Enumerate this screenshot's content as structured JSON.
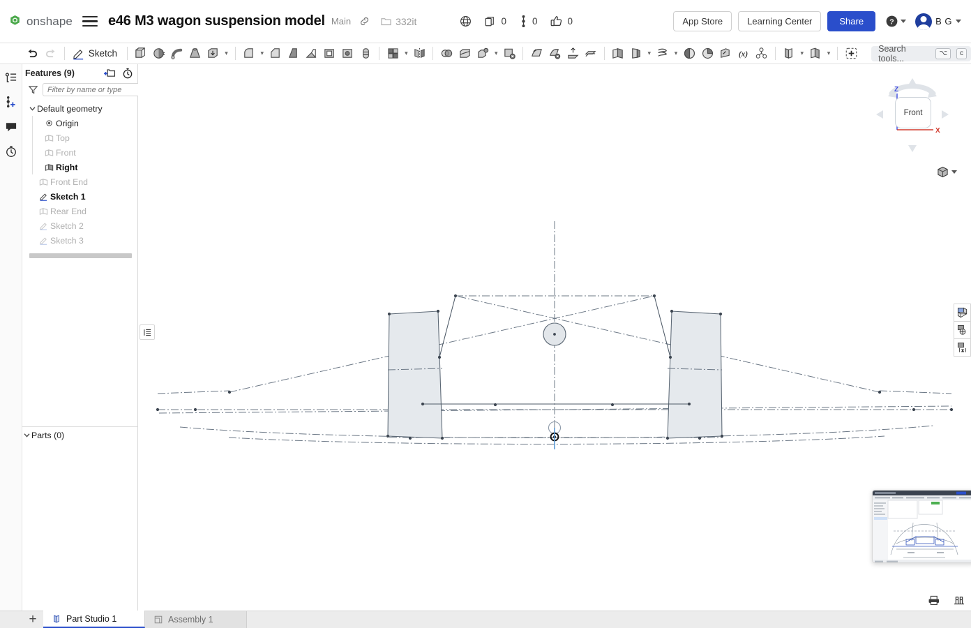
{
  "app": {
    "brand": "onshape"
  },
  "header": {
    "menu_icon": "hamburger-icon",
    "doc_title": "e46 M3 wagon suspension model",
    "branch": "Main",
    "link_icon": "link-icon",
    "folder_icon": "folder-icon",
    "folder_label": "332it",
    "globe_icon": "globe-icon",
    "counters": [
      {
        "icon": "copies-icon",
        "value": "0"
      },
      {
        "icon": "branch-icon",
        "value": "0"
      },
      {
        "icon": "thumbs-up-icon",
        "value": "0"
      }
    ],
    "app_store": "App Store",
    "learning_center": "Learning Center",
    "share": "Share",
    "help_icon": "help-icon",
    "avatar_icon": "avatar-icon",
    "user_initials": "B G"
  },
  "toolbar": {
    "undo": "undo-icon",
    "redo": "redo-icon",
    "sketch_label": "Sketch",
    "tools": [
      "extrude-icon",
      "revolve-icon",
      "sweep-icon",
      "loft-icon",
      "thicken-icon",
      "fillet-icon",
      "chamfer-icon",
      "draft-icon",
      "rib-icon",
      "shell-icon",
      "hole-icon",
      "thread-icon",
      "pattern-icon",
      "mirror-icon",
      "boolean-icon",
      "split-icon",
      "transform-icon",
      "delete-face-icon",
      "move-face-icon",
      "replace-face-icon",
      "plane-icon",
      "sheet-metal-icon",
      "curve-icon",
      "helix-icon",
      "import-icon",
      "variable-icon",
      "assembly-icon",
      "part-icon",
      "config-icon",
      "custom-feature-icon"
    ],
    "search_placeholder": "Search tools...",
    "search_kbd_alt": "⌥",
    "search_kbd_key": "c"
  },
  "rail": {
    "items": [
      {
        "icon": "feature-list-icon",
        "name": "feature-list"
      },
      {
        "icon": "insert-version-icon",
        "name": "insert-version"
      },
      {
        "icon": "comments-icon",
        "name": "comments"
      },
      {
        "icon": "history-icon",
        "name": "history"
      }
    ],
    "bottom_icon": "magnifier-icon"
  },
  "features_panel": {
    "title": "Features (9)",
    "add_folder_icon": "add-folder-icon",
    "history_icon": "stopwatch-icon",
    "filter_icon": "filter-icon",
    "filter_placeholder": "Filter by name or type",
    "group_label": "Default geometry",
    "group_children": [
      {
        "label": "Origin",
        "icon": "origin-icon",
        "state": "normal"
      },
      {
        "label": "Top",
        "icon": "plane-icon",
        "state": "dim"
      },
      {
        "label": "Front",
        "icon": "plane-icon",
        "state": "dim"
      },
      {
        "label": "Right",
        "icon": "plane-icon",
        "state": "strong"
      }
    ],
    "features": [
      {
        "label": "Front End",
        "icon": "plane-icon",
        "state": "dim"
      },
      {
        "label": "Sketch 1",
        "icon": "sketch-icon",
        "state": "strong"
      },
      {
        "label": "Rear End",
        "icon": "plane-icon",
        "state": "dim"
      },
      {
        "label": "Sketch 2",
        "icon": "sketch-icon",
        "state": "dim"
      },
      {
        "label": "Sketch 3",
        "icon": "sketch-icon",
        "state": "dim"
      }
    ],
    "parts_label": "Parts (0)"
  },
  "viewport": {
    "legend_toggle_icon": "list-icon",
    "viewcube_face": "Front",
    "axis_z": "Z",
    "axis_x": "X",
    "display_mode_icon": "shaded-cube-icon",
    "side_tools": [
      {
        "icon": "sketch-display-icon",
        "name": "sketch-display"
      },
      {
        "icon": "dimension-display-icon",
        "name": "dimension-display"
      },
      {
        "icon": "constraint-display-icon",
        "name": "constraint-display"
      }
    ],
    "preview_name": "drawing-preview-thumbnail",
    "bottom_icons": [
      {
        "icon": "print-icon",
        "name": "print"
      },
      {
        "icon": "measure-icon",
        "name": "measure"
      }
    ]
  },
  "tabs": {
    "add_label": "+",
    "items": [
      {
        "label": "Part Studio 1",
        "icon": "part-studio-icon",
        "active": true
      },
      {
        "label": "Assembly 1",
        "icon": "assembly-icon",
        "active": false
      }
    ]
  },
  "colors": {
    "accent": "#2a4ecb",
    "brand_green": "#3aa33a",
    "axis_z": "#3b49df",
    "axis_x": "#d23b2e",
    "sketch_fill": "#e4e8ed",
    "sketch_line": "#5a6673"
  }
}
